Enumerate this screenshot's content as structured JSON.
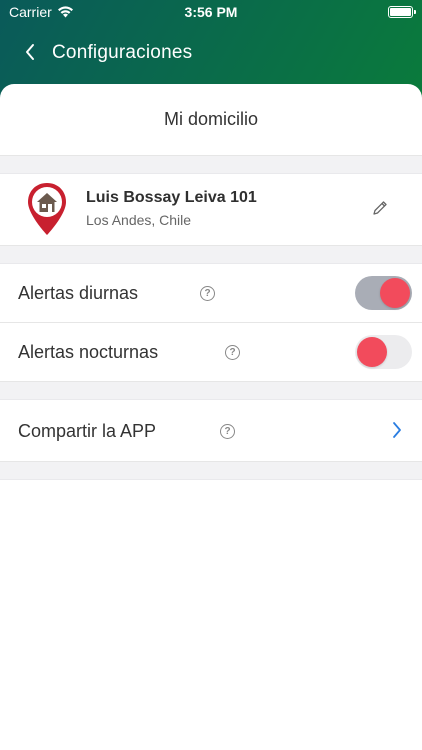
{
  "status_bar": {
    "carrier": "Carrier",
    "time": "3:56 PM"
  },
  "nav": {
    "title": "Configuraciones",
    "back_icon": "chevron-left-icon"
  },
  "sheet": {
    "title": "Mi domicilio"
  },
  "address": {
    "street": "Luis Bossay Leiva 101",
    "city": "Los Andes, Chile",
    "pin_icon": "home-pin-icon",
    "edit_icon": "pencil-icon"
  },
  "alerts": {
    "day": {
      "label": "Alertas diurnas",
      "enabled": true
    },
    "night": {
      "label": "Alertas nocturnas",
      "enabled": false
    }
  },
  "share": {
    "label": "Compartir la APP"
  },
  "colors": {
    "accent_red": "#f24b5c",
    "link_blue": "#2a7de1",
    "header_gradient_start": "#0a5a5a",
    "header_gradient_end": "#1ec43c"
  }
}
